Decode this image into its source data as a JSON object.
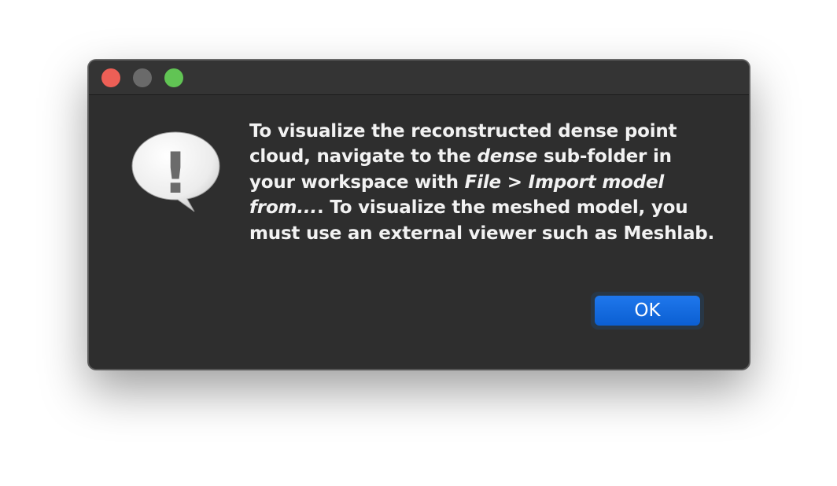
{
  "colors": {
    "window_bg": "#2e2e2e",
    "titlebar_bg": "#343434",
    "close": "#ed5f56",
    "minimize": "#6a6a6a",
    "zoom": "#61c454",
    "button_blue": "#1470e4",
    "focus_ring": "#283746",
    "text": "#f2f2f2"
  },
  "window": {
    "traffic_lights": [
      "close",
      "minimize",
      "zoom"
    ]
  },
  "alert": {
    "icon": "exclamation-speech-bubble-icon",
    "icon_glyph": "!",
    "message": {
      "part1": "To visualize the reconstructed dense point cloud, navigate to the ",
      "em1": "dense",
      "part2": " sub-folder in your workspace with ",
      "em2": "File > Import model from...",
      "part3": ". To visualize the meshed model, you must use an external viewer such as Meshlab."
    }
  },
  "buttons": {
    "ok_label": "OK"
  }
}
